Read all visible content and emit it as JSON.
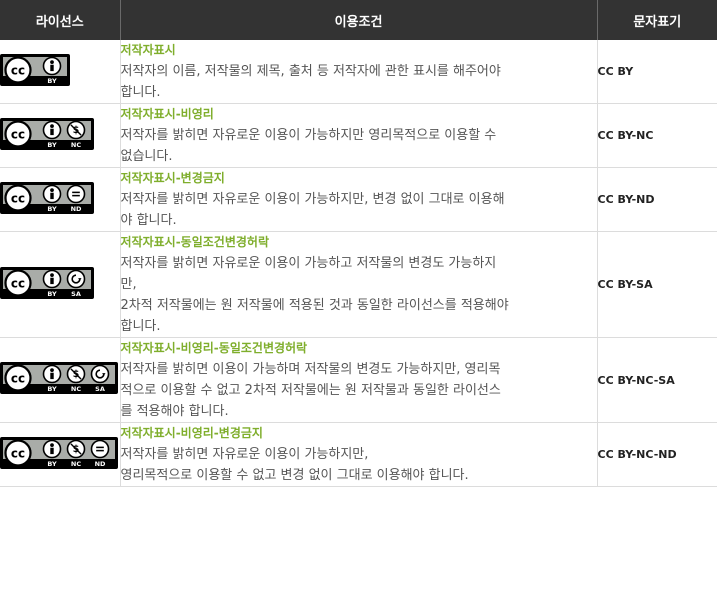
{
  "header": {
    "license": "라이선스",
    "terms": "이용조건",
    "notation": "문자표기"
  },
  "rows": [
    {
      "badge": "cc-by-badge",
      "icons": [
        "by"
      ],
      "labels": [
        "BY"
      ],
      "title": "저작자표시",
      "lines": [
        "저작자의 이름, 저작물의 제목, 출처 등 저작자에 관한 표시를 해주어야",
        "합니다."
      ],
      "code": "CC BY"
    },
    {
      "badge": "cc-by-nc-badge",
      "icons": [
        "by",
        "nc"
      ],
      "labels": [
        "BY",
        "NC"
      ],
      "title": "저작자표시-비영리",
      "lines": [
        "저작자를 밝히면 자유로운 이용이 가능하지만 영리목적으로 이용할 수",
        "없습니다."
      ],
      "code": "CC BY-NC"
    },
    {
      "badge": "cc-by-nd-badge",
      "icons": [
        "by",
        "nd"
      ],
      "labels": [
        "BY",
        "ND"
      ],
      "title": "저작자표시-변경금지",
      "lines": [
        "저작자를 밝히면 자유로운 이용이 가능하지만, 변경 없이 그대로 이용해",
        "야 합니다."
      ],
      "code": "CC BY-ND"
    },
    {
      "badge": "cc-by-sa-badge",
      "icons": [
        "by",
        "sa"
      ],
      "labels": [
        "BY",
        "SA"
      ],
      "title": "저작자표시-동일조건변경허락",
      "lines": [
        "저작자를 밝히면 자유로운 이용이 가능하고 저작물의 변경도 가능하지",
        "만,",
        "2차적 저작물에는 원 저작물에 적용된 것과 동일한 라이선스를 적용해야",
        "합니다."
      ],
      "code": "CC BY-SA"
    },
    {
      "badge": "cc-by-nc-sa-badge",
      "icons": [
        "by",
        "nc",
        "sa"
      ],
      "labels": [
        "BY",
        "NC",
        "SA"
      ],
      "title": "저작자표시-비영리-동일조건변경허락",
      "lines": [
        "저작자를 밝히면 이용이 가능하며 저작물의 변경도 가능하지만, 영리목",
        "적으로 이용할 수 없고 2차적 저작물에는 원 저작물과 동일한 라이선스",
        "를 적용해야 합니다."
      ],
      "code": "CC BY-NC-SA"
    },
    {
      "badge": "cc-by-nc-nd-badge",
      "icons": [
        "by",
        "nc",
        "nd"
      ],
      "labels": [
        "BY",
        "NC",
        "ND"
      ],
      "title": "저작자표시-비영리-변경금지",
      "lines": [
        "저작자를 밝히면 자유로운 이용이 가능하지만,",
        "영리목적으로 이용할 수 없고 변경 없이 그대로 이용해야 합니다."
      ],
      "code": "CC BY-NC-ND"
    }
  ]
}
